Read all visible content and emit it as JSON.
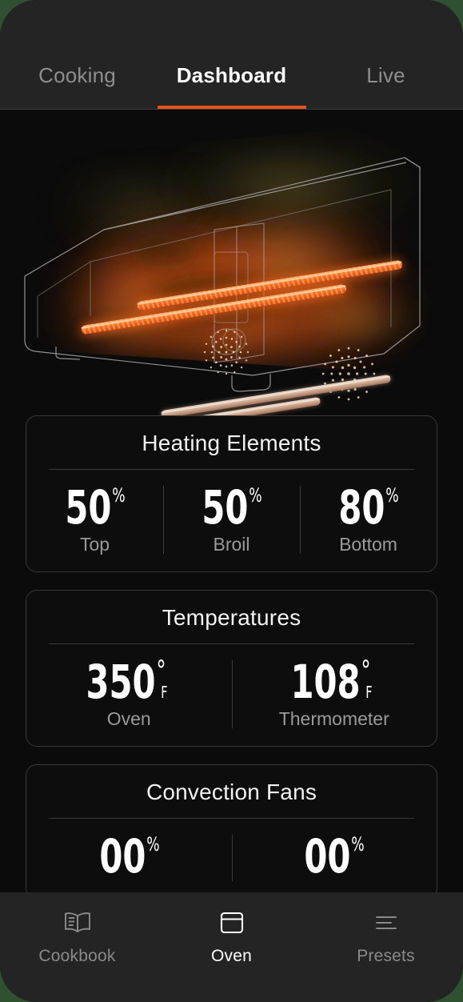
{
  "app": {
    "screen_title": "Dashboard",
    "accent_color": "#e65318",
    "background_color": "#0b0b0b",
    "bar_color": "#242424"
  },
  "tabs": [
    {
      "label": "Cooking",
      "active": false
    },
    {
      "label": "Dashboard",
      "active": true
    },
    {
      "label": "Live",
      "active": false
    }
  ],
  "oven_graphic": {
    "icon": "oven-cutaway-illustration",
    "description": "3D wireframe oven with glowing heating elements and convection heat flow",
    "glow_color": "#ff6a1a",
    "element_colors": [
      "#ff7a28",
      "#ff5a0d"
    ],
    "rack_color": "#d9b9a4",
    "wire_color": "#b9b9b9"
  },
  "cards": [
    {
      "title": "Heating Elements",
      "metrics": [
        {
          "value": "50",
          "unit": "%",
          "label": "Top"
        },
        {
          "value": "50",
          "unit": "%",
          "label": "Broil"
        },
        {
          "value": "80",
          "unit": "%",
          "label": "Bottom"
        }
      ]
    },
    {
      "title": "Temperatures",
      "metrics": [
        {
          "value": "350",
          "unit": "°",
          "sub": "F",
          "label": "Oven"
        },
        {
          "value": "108",
          "unit": "°",
          "sub": "F",
          "label": "Thermometer"
        }
      ]
    },
    {
      "title": "Convection Fans",
      "metrics": [
        {
          "value": "00",
          "unit": "%",
          "label": ""
        },
        {
          "value": "00",
          "unit": "%",
          "label": ""
        }
      ]
    }
  ],
  "bottom_nav": [
    {
      "label": "Cookbook",
      "icon": "open-book-icon",
      "active": false
    },
    {
      "label": "Oven",
      "icon": "oven-box-icon",
      "active": true
    },
    {
      "label": "Presets",
      "icon": "list-lines-icon",
      "active": false
    }
  ]
}
